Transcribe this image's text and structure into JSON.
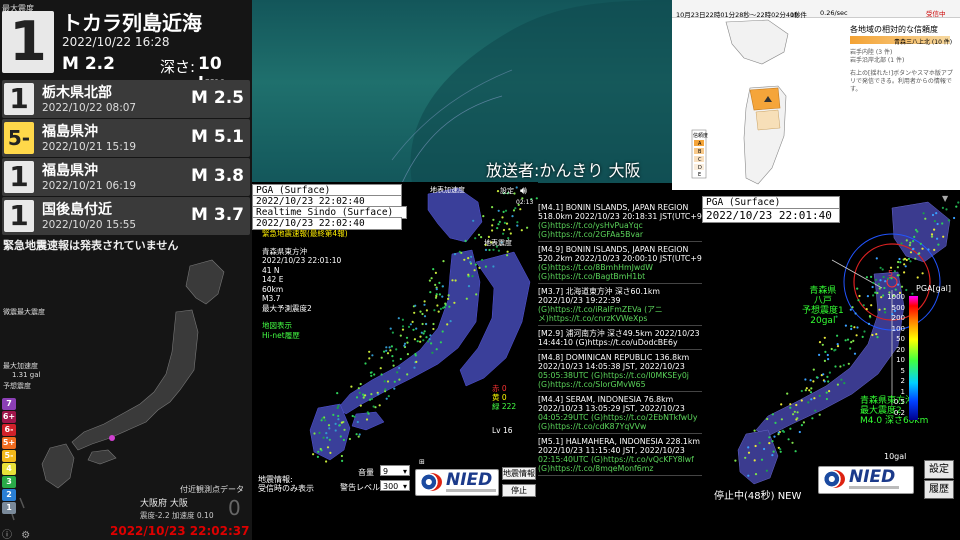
{
  "left": {
    "title": "最大震度",
    "main": {
      "intensity": "1",
      "place": "トカラ列島近海",
      "time": "2022/10/22  16:28",
      "magnitude": "M 2.2",
      "depth_label": "深さ:",
      "depth": "10 km"
    },
    "history": [
      {
        "intensity": "1",
        "place": "栃木県北部",
        "time": "2022/10/22  08:07",
        "magnitude": "M 2.5",
        "bg": "#e8e8e8",
        "fg": "#222"
      },
      {
        "intensity": "5-",
        "place": "福島県沖",
        "time": "2022/10/21  15:19",
        "magnitude": "M 5.1",
        "bg": "#ffd84a",
        "fg": "#222"
      },
      {
        "intensity": "1",
        "place": "福島県沖",
        "time": "2022/10/21  06:19",
        "magnitude": "M 3.8",
        "bg": "#e8e8e8",
        "fg": "#222"
      },
      {
        "intensity": "1",
        "place": "国後島付近",
        "time": "2022/10/20  15:55",
        "magnitude": "M 3.7",
        "bg": "#e8e8e8",
        "fg": "#222"
      }
    ],
    "warning": "緊急地震速報は発表されていません",
    "side_label_1": "微震最大震度",
    "side_label_2": "最大加速度",
    "accel_value": "1.31 gal",
    "side_label_3": "予想震度",
    "scale": [
      {
        "label": "7",
        "color": "#8b3fb5"
      },
      {
        "label": "6+",
        "color": "#a0164a"
      },
      {
        "label": "6-",
        "color": "#d0212a"
      },
      {
        "label": "5+",
        "color": "#ef6b1f"
      },
      {
        "label": "5-",
        "color": "#f2b81a"
      },
      {
        "label": "4",
        "color": "#e8e039"
      },
      {
        "label": "3",
        "color": "#2aaa48"
      },
      {
        "label": "2",
        "color": "#2a7fd4"
      },
      {
        "label": "1",
        "color": "#7a8a9a"
      }
    ],
    "obs_title": "付近観測点データ",
    "obs_name": "大阪府 大阪",
    "obs_detail": "震度-2.2  加速度 0.10",
    "obs_big": "0",
    "clock": "2022/10/23 22:02:37"
  },
  "caption": "放送者:かんきり  大阪",
  "pga_a": {
    "header": "PGA (Surface)",
    "time1": "2022/10/23 22:02:40",
    "sub": "Realtime Sindo (Surface)",
    "time2": "2022/10/23 22:02:40",
    "eew_title": "緊急地震速報(最終第4報)",
    "info_lines": [
      "青森県東方沖",
      "2022/10/23 22:01:10",
      "41 N",
      "142 E",
      "60km",
      "M3.7",
      "最大予測震度2"
    ],
    "map_links": [
      "地図表示",
      "Hi-net履歴"
    ],
    "label_far": "地表加速度",
    "label_far2": "地表震度",
    "setting_label": "設定",
    "clock_small": "02:13",
    "counts": {
      "red": "赤 0",
      "yellow": "黄 0",
      "green": "緑 222"
    },
    "level": "Lv 16",
    "bottom_info_1": "地震情報:",
    "bottom_info_2": "受信時のみ表示",
    "volume_label": "音量",
    "volume_value": "9",
    "alert_label": "警告レベル",
    "alert_value": "300",
    "quake_info_btn": "地震情報",
    "stop_btn": "停止",
    "nied": "NIED"
  },
  "news": [
    {
      "head": "[M4.1] BONIN ISLANDS, JAPAN REGION",
      "l2": "518.0km 2022/10/23 20:18:31 JST(UTC+9)",
      "url": "(G)https://t.co/ysHvPuaYqc",
      "url2": "(G)https://t.co/2GFAa5Bvar"
    },
    {
      "head": "[M4.9] BONIN ISLANDS, JAPAN REGION",
      "l2": "520.2km 2022/10/23 20:00:10 JST(UTC+9)",
      "url": "(G)https://t.co/8BmhHmJwdW",
      "url2": "(G)https://t.co/BagtBmH1bt"
    },
    {
      "head": "[M3.7] 北海道東方沖 深さ60.1km",
      "l2": "2022/10/23 19:22:39",
      "url": "(G)https://t.co/iRaIFmZEVa (アニ",
      "url2": "メ)https://t.co/cnrzKVWeXps"
    },
    {
      "head": "[M2.9] 浦河南方沖 深さ49.5km 2022/10/23",
      "l2": "14:44:10 (G)https://t.co/uDodcBE6y",
      "url": "",
      "url2": ""
    },
    {
      "head": "[M4.8] DOMINICAN REPUBLIC 136.8km",
      "l2": "2022/10/23 14:05:38 JST, 2022/10/23",
      "url": "05:05:38UTC (G)https://t.co/I0MKSEy0j",
      "url2": "(G)https://t.co/SIorGMvW65"
    },
    {
      "head": "[M4.4] SERAM, INDONESIA 76.8km",
      "l2": "2022/10/23 13:05:29 JST, 2022/10/23",
      "url": "04:05:29UTC (G)https://t.co/2EbNTkfwUy",
      "url2": "(G)https://t.co/cdK87YqVVw"
    },
    {
      "head": "[M5.1] HALMAHERA, INDONESIA 228.1km",
      "l2": "2022/10/23 11:15:40 JST, 2022/10/23",
      "url": "02:15:40UTC (G)https://t.co/vQcKFY8lwf",
      "url2": "(G)https://t.co/8mqeMonf6mz"
    }
  ],
  "infowin": {
    "time": "10月23日22時01分28秒〜22時02分40秒",
    "count": "19 件",
    "speed": "0.26/sec",
    "recv": "受信中",
    "title": "各地域の相対的な信頼度",
    "legend": [
      "青森三八上北 (10 件)",
      "岩手内陸 (3 件)",
      "岩手沿岸北部 (1 件)"
    ],
    "note": "右上の[揺れた!]ボタンやスマホ版アプリで発信できる。利用者からの情報です。",
    "scale_letters": [
      "A",
      "B",
      "C",
      "D",
      "E"
    ],
    "scale_title": "信頼度"
  },
  "pga_b": {
    "header": "PGA (Surface)",
    "time": "2022/10/23 22:01:40",
    "colorbar_title": "PGA[gal]",
    "colorbar_ticks": [
      "1000",
      "500",
      "200",
      "100",
      "50",
      "20",
      "10",
      "5",
      "2",
      "1",
      "0.5",
      "0.2"
    ],
    "callout1": [
      "青森県",
      "八戸",
      "予想震度1",
      "20gal"
    ],
    "callout2": [
      "青森県東方沖",
      "最大震度2",
      "M4.0 深さ60km"
    ],
    "epicenter_mark": "5",
    "gal_label": "10gal",
    "setting_btn": "設定",
    "history_btn": "履歴",
    "status": "停止中(48秒) NEW",
    "nied": "NIED"
  }
}
